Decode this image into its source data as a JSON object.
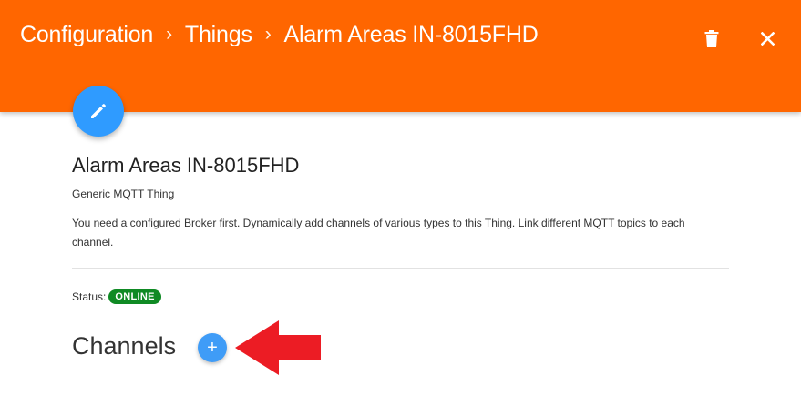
{
  "header": {
    "breadcrumb": [
      "Configuration",
      "Things",
      "Alarm Areas IN-8015FHD"
    ],
    "separator": "›",
    "background_color": "#ff6600",
    "actions": [
      {
        "icon": "trash-icon"
      },
      {
        "icon": "close-icon"
      }
    ]
  },
  "thing": {
    "edit_icon": "pencil-icon",
    "title": "Alarm Areas IN-8015FHD",
    "type": "Generic MQTT Thing",
    "description": "You need a configured Broker first. Dynamically add channels of various types to this Thing. Link different MQTT topics to each channel.",
    "status_label": "Status:",
    "status_value": "ONLINE",
    "status_color": "#0f8a24"
  },
  "channels": {
    "heading": "Channels",
    "add_label": "+",
    "add_color": "#3f9cf7"
  },
  "annotation": {
    "shape": "arrow-left",
    "color": "#ec1c24"
  }
}
